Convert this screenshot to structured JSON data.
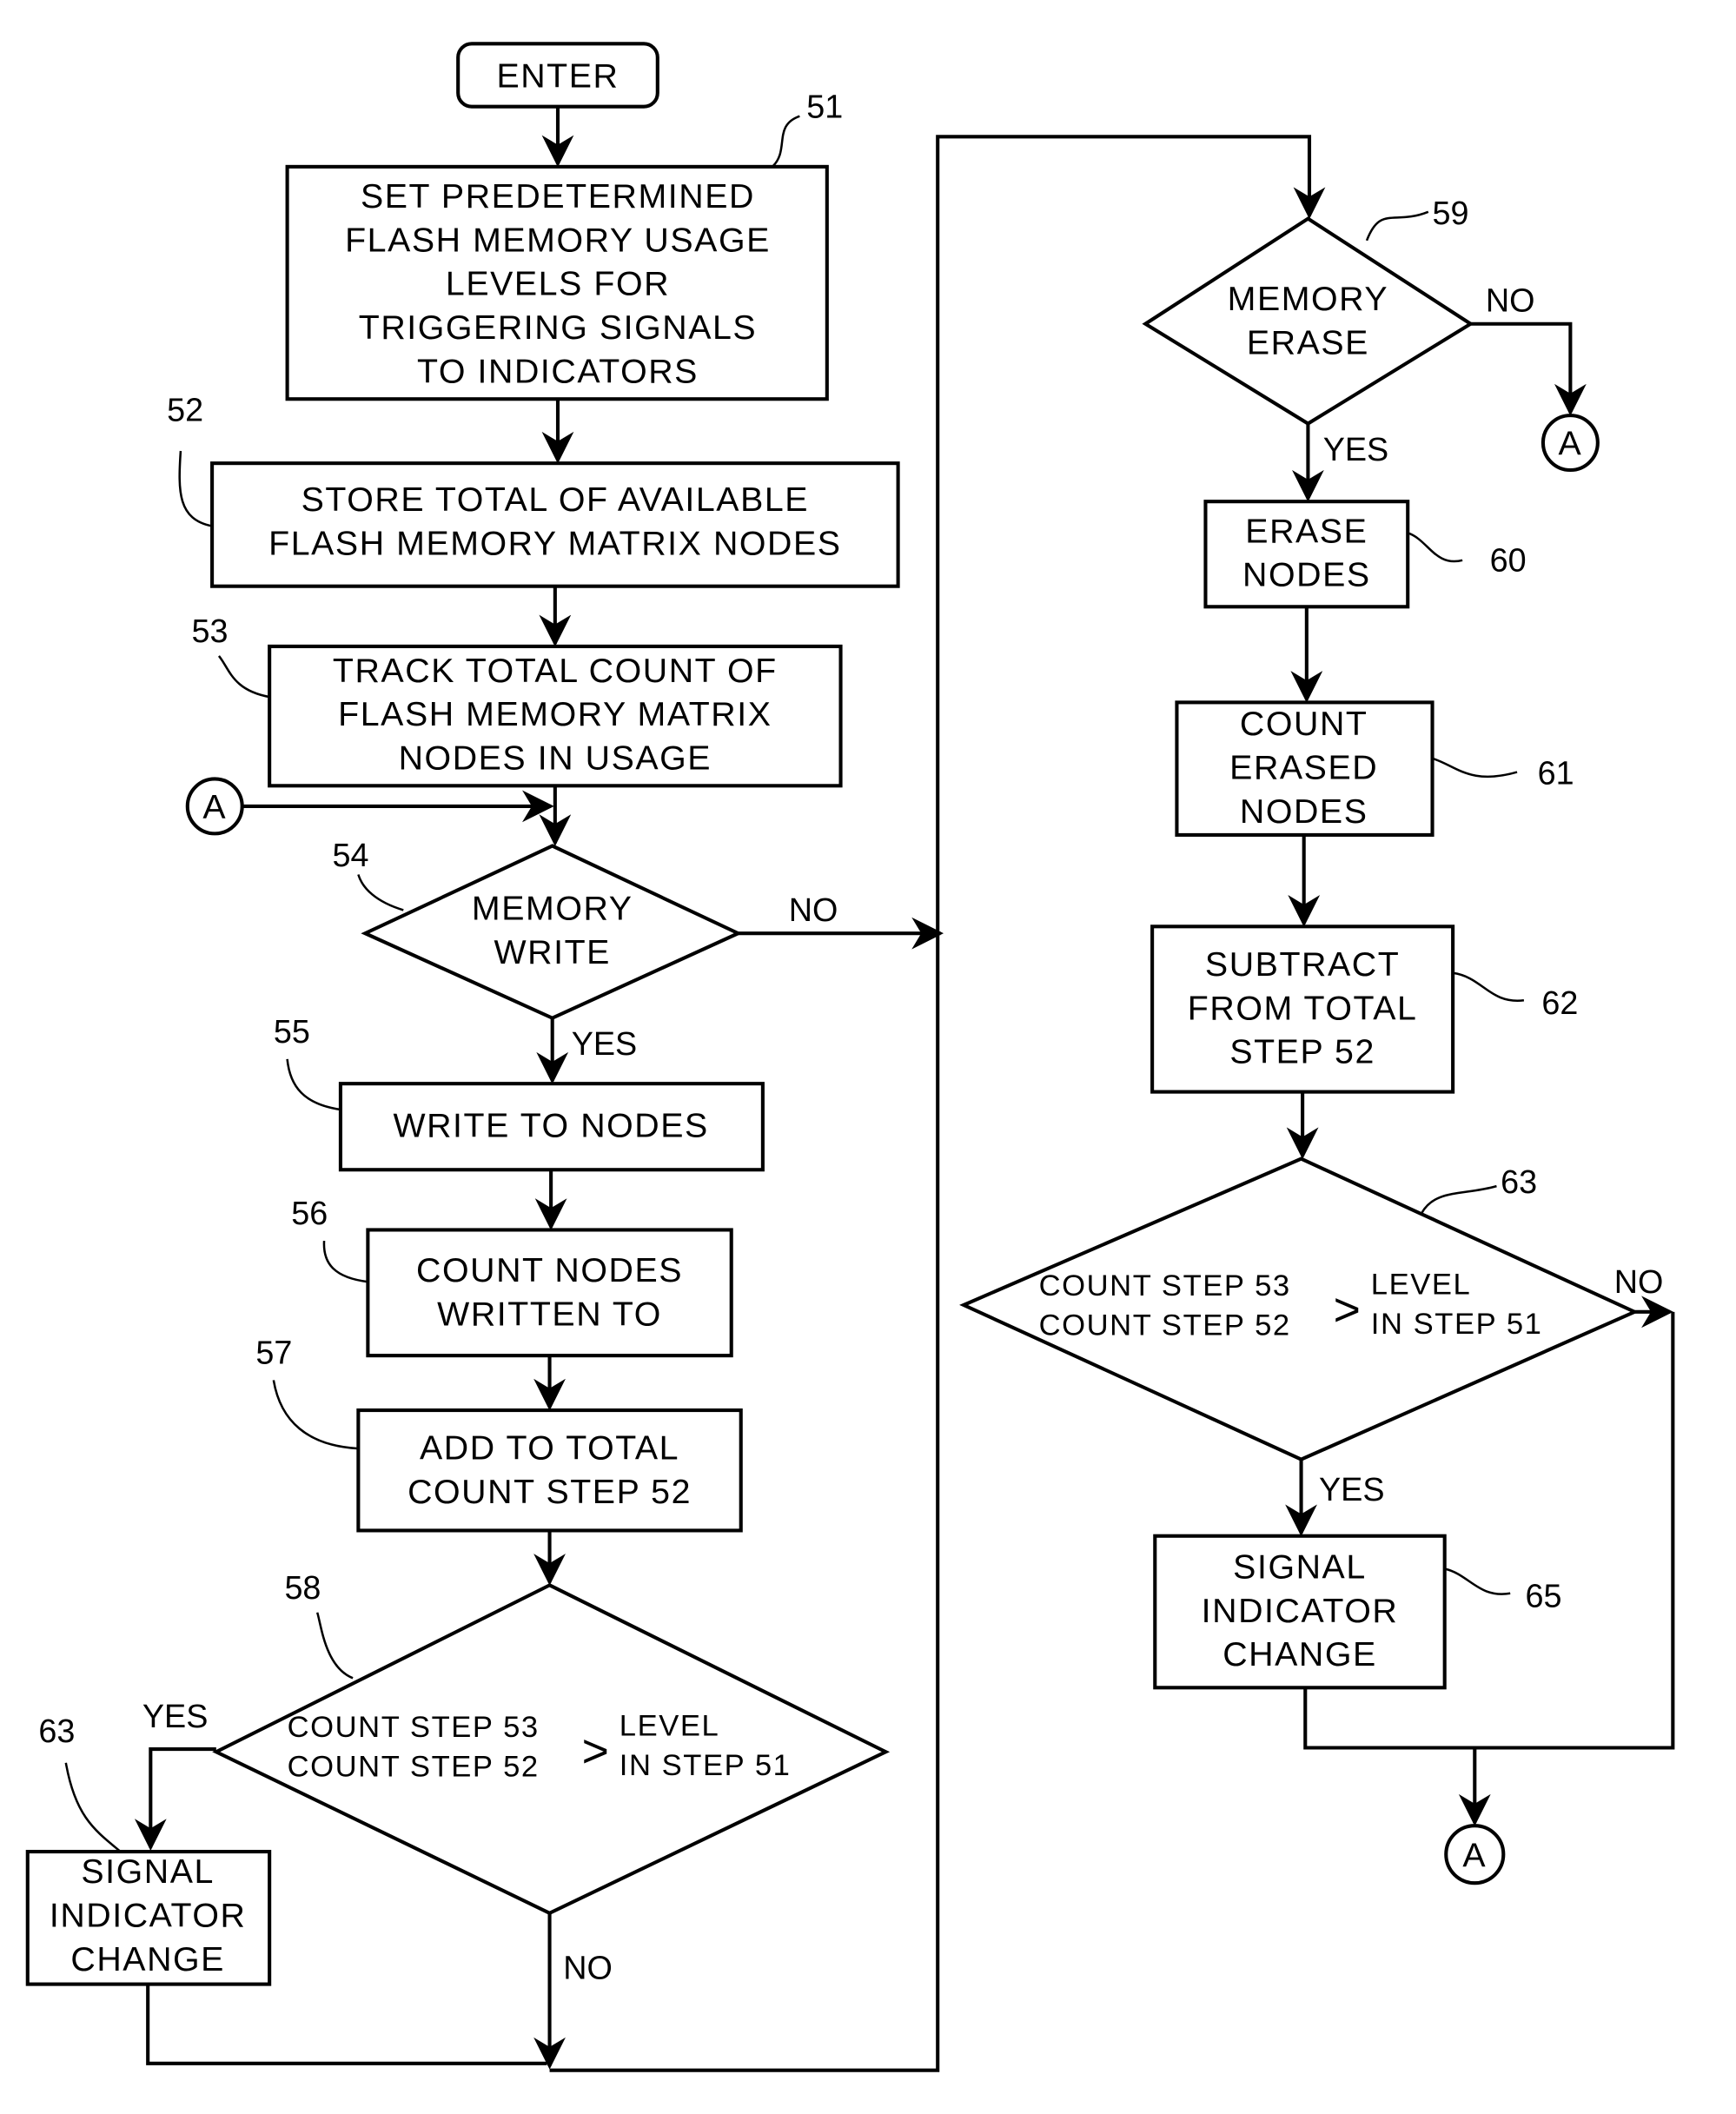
{
  "start": {
    "label": "ENTER"
  },
  "connector_label": "A",
  "steps": {
    "s51": {
      "ref": "51",
      "lines": [
        "SET PREDETERMINED",
        "FLASH MEMORY USAGE",
        "LEVELS FOR",
        "TRIGGERING SIGNALS",
        "TO INDICATORS"
      ]
    },
    "s52": {
      "ref": "52",
      "lines": [
        "STORE TOTAL OF AVAILABLE",
        "FLASH MEMORY MATRIX NODES"
      ]
    },
    "s53": {
      "ref": "53",
      "lines": [
        "TRACK TOTAL COUNT OF",
        "FLASH MEMORY MATRIX",
        "NODES IN USAGE"
      ]
    },
    "s54": {
      "ref": "54",
      "lines": [
        "MEMORY",
        "WRITE"
      ]
    },
    "s55": {
      "ref": "55",
      "lines": [
        "WRITE TO NODES"
      ]
    },
    "s56": {
      "ref": "56",
      "lines": [
        "COUNT NODES",
        "WRITTEN TO"
      ]
    },
    "s57": {
      "ref": "57",
      "lines": [
        "ADD TO TOTAL",
        "COUNT STEP 52"
      ]
    },
    "s58": {
      "ref": "58",
      "left": [
        "COUNT STEP 53",
        "COUNT STEP 52"
      ],
      "op": ">",
      "right": [
        "LEVEL",
        "IN STEP 51"
      ]
    },
    "s63a": {
      "ref": "63",
      "lines": [
        "SIGNAL",
        "INDICATOR",
        "CHANGE"
      ]
    },
    "s59": {
      "ref": "59",
      "lines": [
        "MEMORY",
        "ERASE"
      ]
    },
    "s60": {
      "ref": "60",
      "lines": [
        "ERASE",
        "NODES"
      ]
    },
    "s61": {
      "ref": "61",
      "lines": [
        "COUNT",
        "ERASED",
        "NODES"
      ]
    },
    "s62": {
      "ref": "62",
      "lines": [
        "SUBTRACT",
        "FROM TOTAL",
        "STEP 52"
      ]
    },
    "s63": {
      "ref": "63",
      "left": [
        "COUNT STEP 53",
        "COUNT STEP 52"
      ],
      "op": ">",
      "right": [
        "LEVEL",
        "IN STEP 51"
      ]
    },
    "s65": {
      "ref": "65",
      "lines": [
        "SIGNAL",
        "INDICATOR",
        "CHANGE"
      ]
    }
  },
  "branch_labels": {
    "yes": "YES",
    "no": "NO"
  }
}
